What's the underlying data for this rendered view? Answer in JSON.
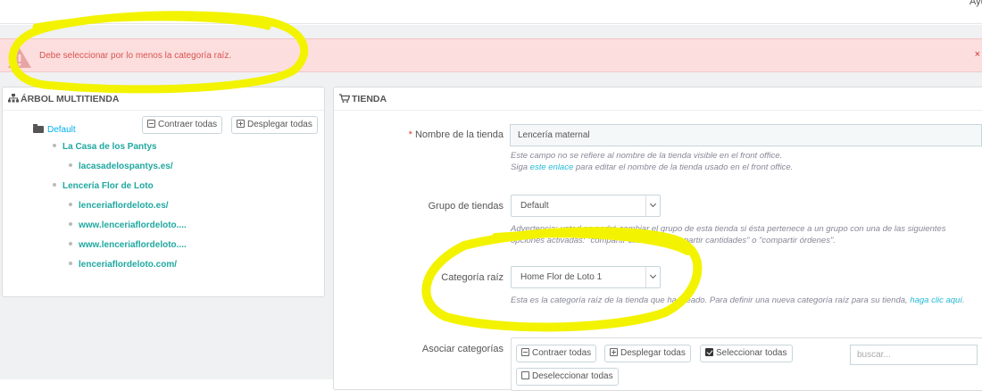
{
  "header": {
    "right_text": "Ayuda"
  },
  "alert": {
    "message": "Debe seleccionar por lo menos la categoría raíz.",
    "close": "×"
  },
  "tree_panel": {
    "title": "ÁRBOL MULTITIENDA",
    "collapse_label": "Contraer todas",
    "expand_label": "Desplegar todas",
    "root": "Default",
    "groups": [
      {
        "name": "La Casa de los Pantys",
        "shops": [
          "lacasadelospantys.es/"
        ]
      },
      {
        "name": "Lencería Flor de Loto",
        "shops": [
          "lenceriaflordeloto.es/",
          "www.lenceriaflordeloto....",
          "www.lenceriaflordeloto....",
          "lenceriaflordeloto.com/"
        ]
      }
    ]
  },
  "shop_panel": {
    "title": "TIENDA",
    "name_label": "Nombre de la tienda",
    "name_value": "Lencería maternal",
    "name_help_1": "Este campo no se refiere al nombre de la tienda visible en el front office.",
    "name_help_2a": "Siga",
    "name_help_link": "este enlace",
    "name_help_2b": "para editar el nombre de la tienda usado en el front office.",
    "group_label": "Grupo de tiendas",
    "group_value": "Default",
    "group_help": "Advertencia: usted no podrá cambiar el grupo de esta tienda si ésta pertenece a un grupo con una de las siguientes opciones activadas: \"compartir clientes\", \"compartir cantidades\" o \"compartir órdenes\".",
    "root_label": "Categoría raíz",
    "root_value": "Home Flor de Loto 1",
    "root_help": "Esta es la categoría raíz de la tienda que ha creado. Para definir una nueva categoría raíz para su tienda,",
    "root_help_link": "haga clic aquí",
    "assoc_label": "Asociar categorías",
    "assoc_collapse": "Contraer todas",
    "assoc_expand": "Desplegar todas",
    "assoc_select": "Seleccionar todas",
    "assoc_deselect": "Deseleccionar todas",
    "search_placeholder": "buscar..."
  },
  "colors": {
    "alert_bg": "#fcdede",
    "alert_text": "#d9534f",
    "highlight": "#f5f500",
    "link": "#25b9d7"
  }
}
